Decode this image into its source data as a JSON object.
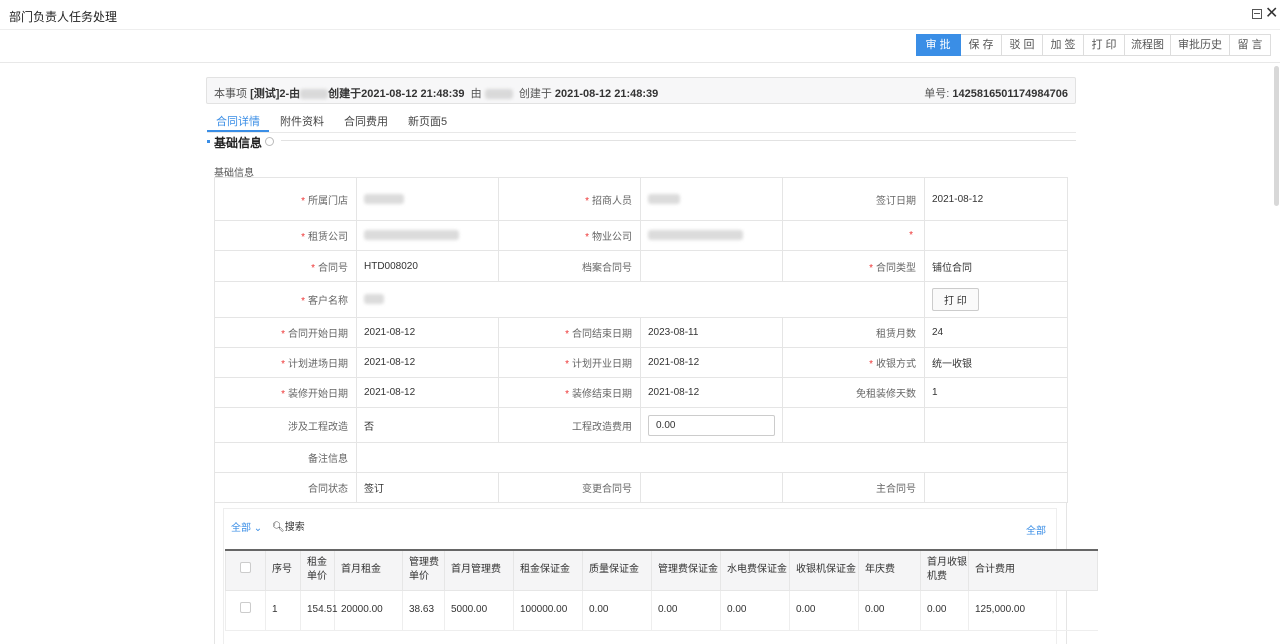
{
  "window": {
    "title": "部门负责人任务处理"
  },
  "toolbar": {
    "buttons": [
      "审 批",
      "保 存",
      "驳 回",
      "加 签",
      "打 印",
      "流程图",
      "审批历史",
      "留 言"
    ]
  },
  "infobar": {
    "prefix": "本事项 ",
    "title_start": "[测试]2-由",
    "title_end": "创建于2021-08-12 21:48:39",
    "by": "由",
    "created_label": "创建于",
    "created_time": "2021-08-12 21:48:39",
    "order_label": "单号:",
    "order_no": "1425816501174984706"
  },
  "tabs": [
    "合同详情",
    "附件资料",
    "合同费用",
    "新页面5"
  ],
  "section": {
    "title": "基础信息",
    "subtitle": "基础信息"
  },
  "form": {
    "store": {
      "label": "所属门店",
      "value": ""
    },
    "recruiter": {
      "label": "招商人员",
      "value": ""
    },
    "sign_date": {
      "label": "签订日期",
      "value": "2021-08-12"
    },
    "lease_company": {
      "label": "租赁公司",
      "value": ""
    },
    "property_company": {
      "label": "物业公司",
      "value": ""
    },
    "contract_no": {
      "label": "合同号",
      "value": "HTD008020"
    },
    "archive_no": {
      "label": "档案合同号",
      "value": ""
    },
    "contract_type": {
      "label": "合同类型",
      "value": "铺位合同"
    },
    "customer": {
      "label": "客户名称",
      "value": ""
    },
    "print_button": "打 印",
    "start_date": {
      "label": "合同开始日期",
      "value": "2021-08-12"
    },
    "end_date": {
      "label": "合同结束日期",
      "value": "2023-08-11"
    },
    "lease_months": {
      "label": "租赁月数",
      "value": "24"
    },
    "plan_entry": {
      "label": "计划进场日期",
      "value": "2021-08-12"
    },
    "plan_open": {
      "label": "计划开业日期",
      "value": "2021-08-12"
    },
    "cashier_mode": {
      "label": "收银方式",
      "value": "统一收银"
    },
    "deco_start": {
      "label": "装修开始日期",
      "value": "2021-08-12"
    },
    "deco_end": {
      "label": "装修结束日期",
      "value": "2021-08-12"
    },
    "free_days": {
      "label": "免租装修天数",
      "value": "1"
    },
    "engineering": {
      "label": "涉及工程改造",
      "value": "否"
    },
    "engineering_fee": {
      "label": "工程改造费用",
      "value": "0.00"
    },
    "remark": {
      "label": "备注信息",
      "value": ""
    },
    "status": {
      "label": "合同状态",
      "value": "签订"
    },
    "change_no": {
      "label": "变更合同号",
      "value": ""
    },
    "master_no": {
      "label": "主合同号",
      "value": ""
    }
  },
  "subgrid": {
    "filter_label": "全部",
    "search_label": "搜索",
    "all_link": "全部",
    "columns": [
      "序号",
      "租金单价",
      "首月租金",
      "管理费单价",
      "首月管理费",
      "租金保证金",
      "质量保证金",
      "管理费保证金",
      "水电费保证金",
      "收银机保证金",
      "年庆费",
      "首月收银机费",
      "合计费用"
    ],
    "rows": [
      [
        "1",
        "154.51",
        "20000.00",
        "38.63",
        "5000.00",
        "100000.00",
        "0.00",
        "0.00",
        "0.00",
        "0.00",
        "0.00",
        "0.00",
        "125,000.00"
      ]
    ]
  }
}
